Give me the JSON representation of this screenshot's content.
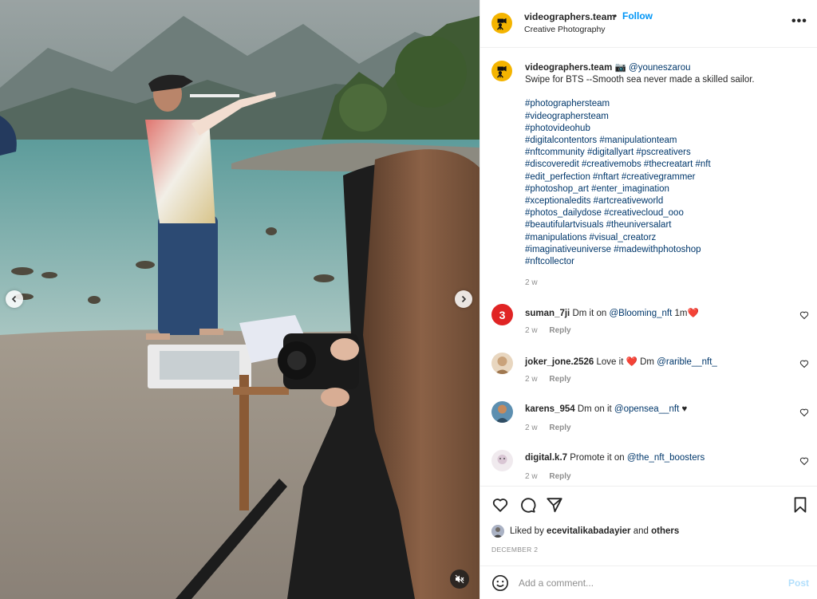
{
  "post": {
    "username": "videographers.team",
    "dot": "•",
    "follow_label": "Follow",
    "subtitle": "Creative Photography",
    "more_label": "•••"
  },
  "caption": {
    "username": "videographers.team",
    "camera_emoji": "📷",
    "mention": "@youneszarou",
    "text": "Swipe for BTS --Smooth sea never made a skilled sailor.",
    "hashtag_lines": [
      "#photographersteam",
      "#videographersteam",
      "#photovideohub",
      "#digitalcontentors #manipulationteam",
      "#nftcommunity #digitallyart #pscreativers",
      "#discoveredit #creativemobs #thecreatart #nft",
      "#edit_perfection #nftart #creativegrammer",
      "#photoshop_art #enter_imagination",
      "#xceptionaledits #artcreativeworld",
      "#photos_dailydose #creativecloud_ooo",
      "#beautifulartvisuals #theuniversalart",
      "#manipulations #visual_creatorz",
      "#imaginativeuniverse #madewithphotoshop",
      "#nftcollector"
    ],
    "time": "2 w"
  },
  "comments": [
    {
      "username": "suman_7ji",
      "pre": "Dm it on",
      "mention": "@Blooming_nft",
      "post": "1m❤️",
      "time": "2 w",
      "reply": "Reply",
      "avatar_color": "#e02424",
      "avatar_text": "3"
    },
    {
      "username": "joker_jone.2526",
      "pre": "Love it ❤️ Dm",
      "mention": "@rarible__nft_",
      "post": "",
      "time": "2 w",
      "reply": "Reply",
      "avatar_color": "#c9a27a",
      "avatar_text": ""
    },
    {
      "username": "karens_954",
      "pre": "Dm on it",
      "mention": "@opensea__nft",
      "post": "♥",
      "time": "2 w",
      "reply": "Reply",
      "avatar_color": "#3b6e8c",
      "avatar_text": ""
    },
    {
      "username": "digital.k.7",
      "pre": "Promote it on",
      "mention": "@the_nft_boosters",
      "post": "",
      "time": "2 w",
      "reply": "Reply",
      "avatar_color": "#e8e0e6",
      "avatar_text": ""
    }
  ],
  "likes": {
    "prefix": "Liked by",
    "user": "ecevitalikabadayier",
    "and": "and",
    "others": "others"
  },
  "date": "DECEMBER 2",
  "add_comment": {
    "placeholder": "Add a comment...",
    "post_label": "Post"
  },
  "icons": {
    "logo": "camera-tripod-logo-icon",
    "like": "heart-icon",
    "comment": "speech-bubble-icon",
    "share": "paper-plane-icon",
    "save": "bookmark-icon",
    "emoji": "smiley-icon",
    "mute": "speaker-muted-icon",
    "prev": "chevron-left-icon",
    "next": "chevron-right-icon"
  },
  "colors": {
    "accent": "#0095f6",
    "link": "#00376b",
    "muted": "#8e8e8e",
    "logo_bg": "#f4b400"
  }
}
